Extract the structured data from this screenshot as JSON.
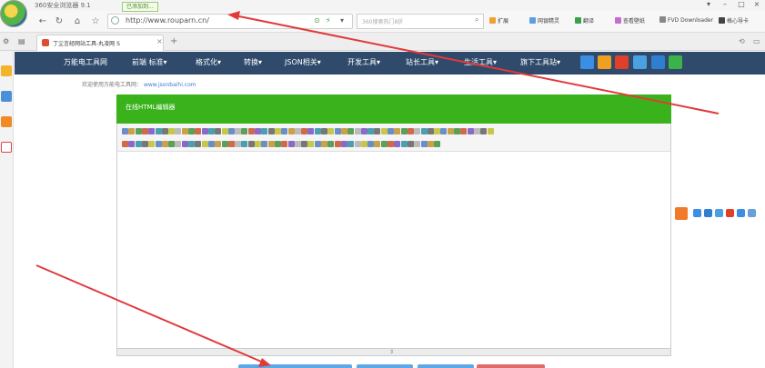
{
  "browser": {
    "title": "360安全浏览器 9.1",
    "tooltip": "已添加到...",
    "address": "http://www.rouparn.cn/",
    "search_placeholder": "360搜索热门8折",
    "bookmarks": [
      "扩展",
      "网银精灵",
      "翻译",
      "查看壁纸",
      "FVD Downloader",
      "格心导卡"
    ],
    "tab_title": "丁尘言经网站工具-丸凌网 S"
  },
  "site": {
    "nav": [
      "万能电工具网",
      "前端 标准▾",
      "格式化▾",
      "转换▾",
      "JSON相关▾",
      "开发工具▾",
      "站长工具▾",
      "生活工具▾",
      "旗下工具站▾"
    ],
    "welcome": "欢迎使用万能电工具网：",
    "welcome_link": "www.jsonbaihi.com"
  },
  "editor": {
    "title": "在线HTML编辑器"
  },
  "colors": {
    "nav_bg": "#2f4a6b",
    "editor_header": "#39b21c",
    "arrow": "#e23a3a"
  }
}
